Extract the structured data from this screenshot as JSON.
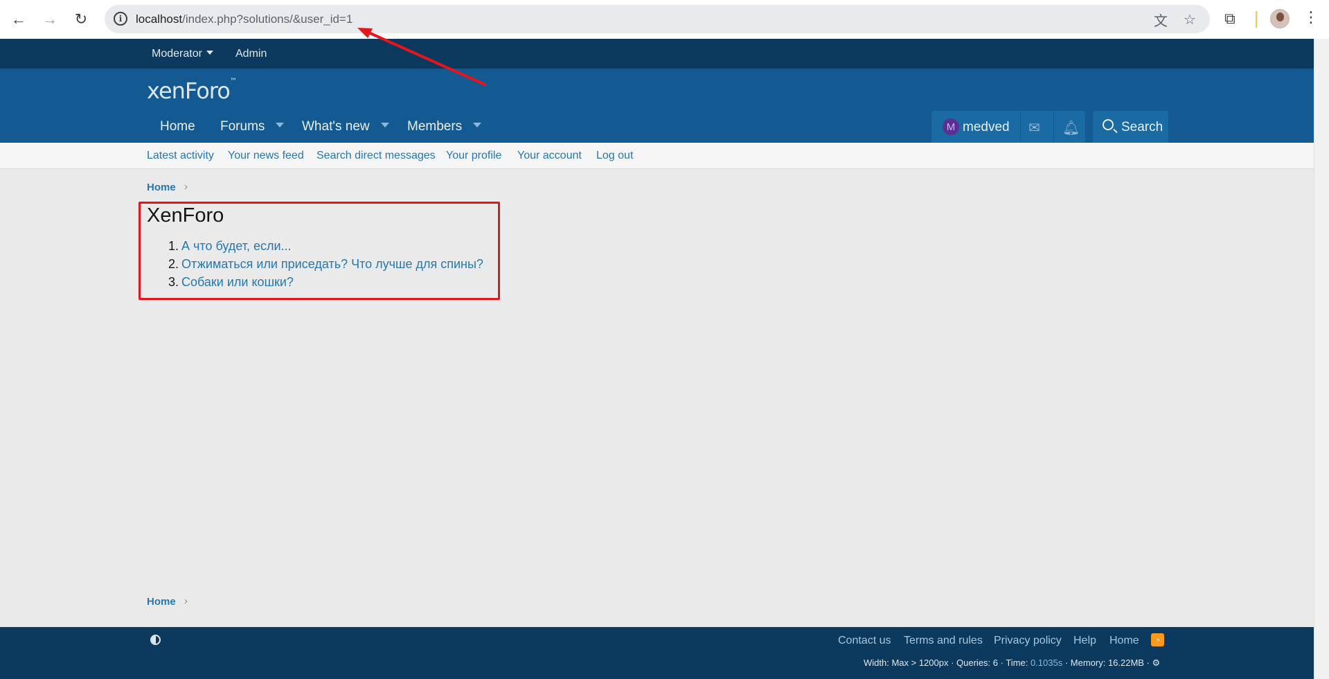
{
  "browser": {
    "url_host": "localhost",
    "url_path": "/index.php?solutions/&user_id=1"
  },
  "staffbar": {
    "moderator_label": "Moderator",
    "admin_label": "Admin"
  },
  "header": {
    "logo_text": "xenForo",
    "nav": [
      {
        "label": "Home"
      },
      {
        "label": "Forums"
      },
      {
        "label": "What's new"
      },
      {
        "label": "Members"
      }
    ],
    "user": {
      "avatar_letter": "M",
      "name": "medved"
    },
    "search_label": "Search"
  },
  "subnav": [
    {
      "label": "Latest activity"
    },
    {
      "label": "Your news feed"
    },
    {
      "label": "Search direct messages"
    },
    {
      "label": "Your profile"
    },
    {
      "label": "Your account"
    },
    {
      "label": "Log out"
    }
  ],
  "breadcrumb": {
    "top": "Home",
    "bottom": "Home"
  },
  "content": {
    "title": "XenForo",
    "items": [
      {
        "num": "1.",
        "label": "А что будет, если..."
      },
      {
        "num": "2.",
        "label": "Отжиматься или приседать? Что лучше для спины?"
      },
      {
        "num": "3.",
        "label": "Собаки или кошки?"
      }
    ]
  },
  "footer": {
    "links": [
      {
        "label": "Contact us"
      },
      {
        "label": "Terms and rules"
      },
      {
        "label": "Privacy policy"
      },
      {
        "label": "Help"
      },
      {
        "label": "Home"
      }
    ],
    "debug_prefix": "Width: Max > 1200px · Queries: 6 · Time: ",
    "debug_time": "0.1035s",
    "debug_suffix": " · Memory: 16.22MB ·"
  },
  "icons": {
    "back": "arrow-left-icon",
    "forward": "arrow-right-icon",
    "reload": "reload-icon",
    "info": "info-icon",
    "translate": "translate-icon",
    "bookmark": "star-icon",
    "extensions": "puzzle-icon",
    "menu": "kebab-menu-icon",
    "mail": "envelope-icon",
    "alerts": "bell-icon",
    "theme": "contrast-icon",
    "rss": "rss-icon",
    "debug": "gear-icon"
  },
  "colors": {
    "staffbar": "#0b3a5e",
    "header": "#125a91",
    "link": "#2577b1",
    "annotation": "#e8141c"
  }
}
